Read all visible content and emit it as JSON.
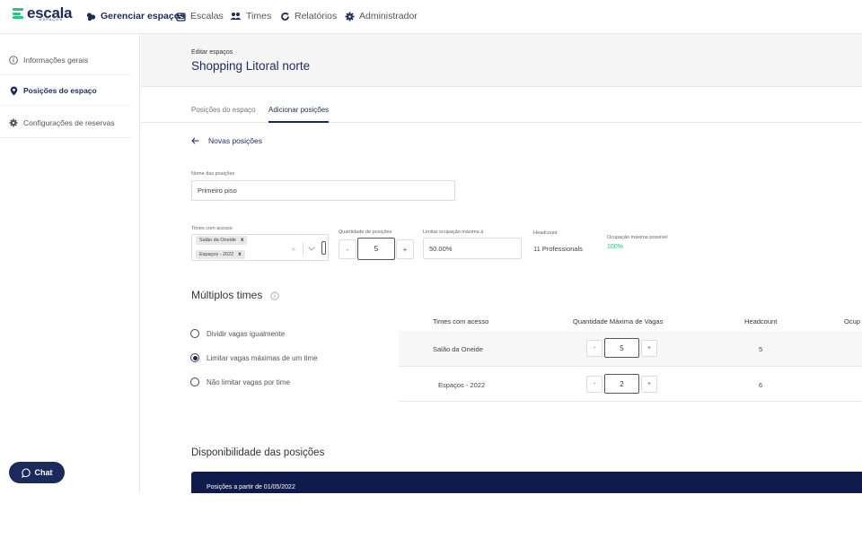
{
  "brand": {
    "name": "escala",
    "sub": "ESPAÇOS",
    "color": "#1a2a5c",
    "accent": "#2ec27e"
  },
  "topnav": {
    "items": [
      {
        "label": "Gerenciar espaços",
        "icon": "buildings-icon"
      },
      {
        "label": "Escalas",
        "icon": "calendar-icon"
      },
      {
        "label": "Times",
        "icon": "people-icon"
      },
      {
        "label": "Relatórios",
        "icon": "refresh-icon"
      },
      {
        "label": "Administrador",
        "icon": "gear-icon"
      }
    ]
  },
  "sidebar": {
    "items": [
      {
        "label": "Informações gerais",
        "icon": "info-icon"
      },
      {
        "label": "Posições do espaço",
        "icon": "pin-icon"
      },
      {
        "label": "Configurações de reservas",
        "icon": "gear-icon"
      }
    ],
    "chat_label": "Chat"
  },
  "header": {
    "eyebrow": "Editar espaços",
    "title": "Shopping Litoral norte"
  },
  "tabs": [
    {
      "label": "Posições do espaço"
    },
    {
      "label": "Adicionar posições"
    }
  ],
  "back_label": "Novas posições",
  "form": {
    "name_label": "Nome das posições",
    "name_value": "Primeiro piso",
    "teams_label": "Times com acesso",
    "teams_chips": [
      "Salão da Oneide",
      "Espaços - 2022"
    ],
    "chip_remove": "x",
    "clear_icon": "×",
    "qty_label": "Quantidade de posições",
    "qty_minus": "-",
    "qty_value": "5",
    "qty_plus": "+",
    "limit_label": "Limitar ocupação máxima à",
    "limit_value": "50.00%",
    "headcount_label": "Headcount",
    "headcount_value": "11 Professionals",
    "max_occ_label": "Ocupação máxima possível",
    "max_occ_value": "100%"
  },
  "multi": {
    "title": "Múltiplos times",
    "options": [
      {
        "label": "Dividir vagas igualmente",
        "selected": false
      },
      {
        "label": "Limitar vagas máximas de um time",
        "selected": true
      },
      {
        "label": "Não limitar vagas por time",
        "selected": false
      }
    ],
    "columns": [
      "Times com acesso",
      "Quantidade Máxima de Vagas",
      "Headcount",
      "Ocup"
    ],
    "rows": [
      {
        "team": "Salão da Oneide",
        "minus": "-",
        "max": "5",
        "plus": "+",
        "headcount": "5"
      },
      {
        "team": "Espaços - 2022",
        "minus": "-",
        "max": "2",
        "plus": "+",
        "headcount": "6"
      }
    ]
  },
  "availability": {
    "title": "Disponibilidade das posições",
    "bar_text": "Posições a partir de 01/05/2022"
  }
}
